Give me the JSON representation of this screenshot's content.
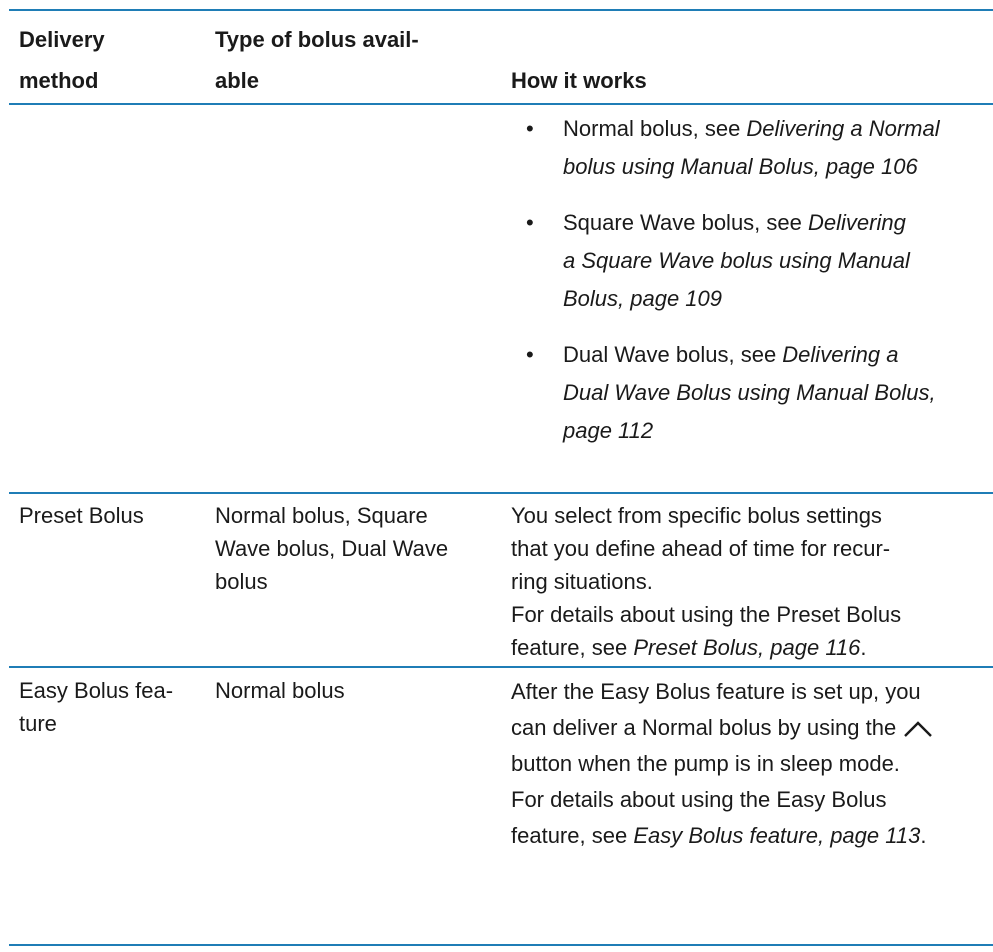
{
  "colors": {
    "rule": "#1f7db6",
    "text": "#1a1a1a"
  },
  "headers": {
    "delivery_method_1": "Delivery",
    "delivery_method_2": "method",
    "type_1": "Type of bolus avail-",
    "type_2": "able",
    "how": "How it works"
  },
  "bullets": [
    {
      "lead": "Normal bolus, see ",
      "ref1": "Delivering a Normal",
      "ref2": "bolus using Manual Bolus, page 106"
    },
    {
      "lead": "Square Wave bolus, see ",
      "ref1": "Delivering",
      "ref2": "a Square Wave bolus using Manual",
      "ref3": "Bolus, page 109"
    },
    {
      "lead": "Dual Wave bolus, see ",
      "ref1": "Delivering a",
      "ref2": "Dual Wave Bolus using Manual Bolus,",
      "ref3": "page 112"
    }
  ],
  "rows": [
    {
      "method": "Preset Bolus",
      "type_lines": [
        "Normal bolus, Square",
        "Wave bolus, Dual Wave",
        "bolus"
      ],
      "how_lines": [
        "You select from specific bolus settings",
        "that you define ahead of time for recur-",
        "ring situations."
      ],
      "details_1": "For details about using the Preset Bolus",
      "details_2": "feature, see ",
      "details_ref": "Preset Bolus, page 116",
      "details_end": "."
    },
    {
      "method_1": "Easy Bolus fea-",
      "method_2": "ture",
      "type": "Normal bolus",
      "how_1": "After the Easy Bolus feature is set up, you",
      "how_2": "can deliver a Normal bolus by using the",
      "how_3": "button when the pump is in sleep mode.",
      "details_1": "For details about using the Easy Bolus",
      "details_2": "feature, see ",
      "details_ref": "Easy Bolus feature, page 113",
      "details_end": ".",
      "icon": "up-arrow-icon"
    }
  ]
}
